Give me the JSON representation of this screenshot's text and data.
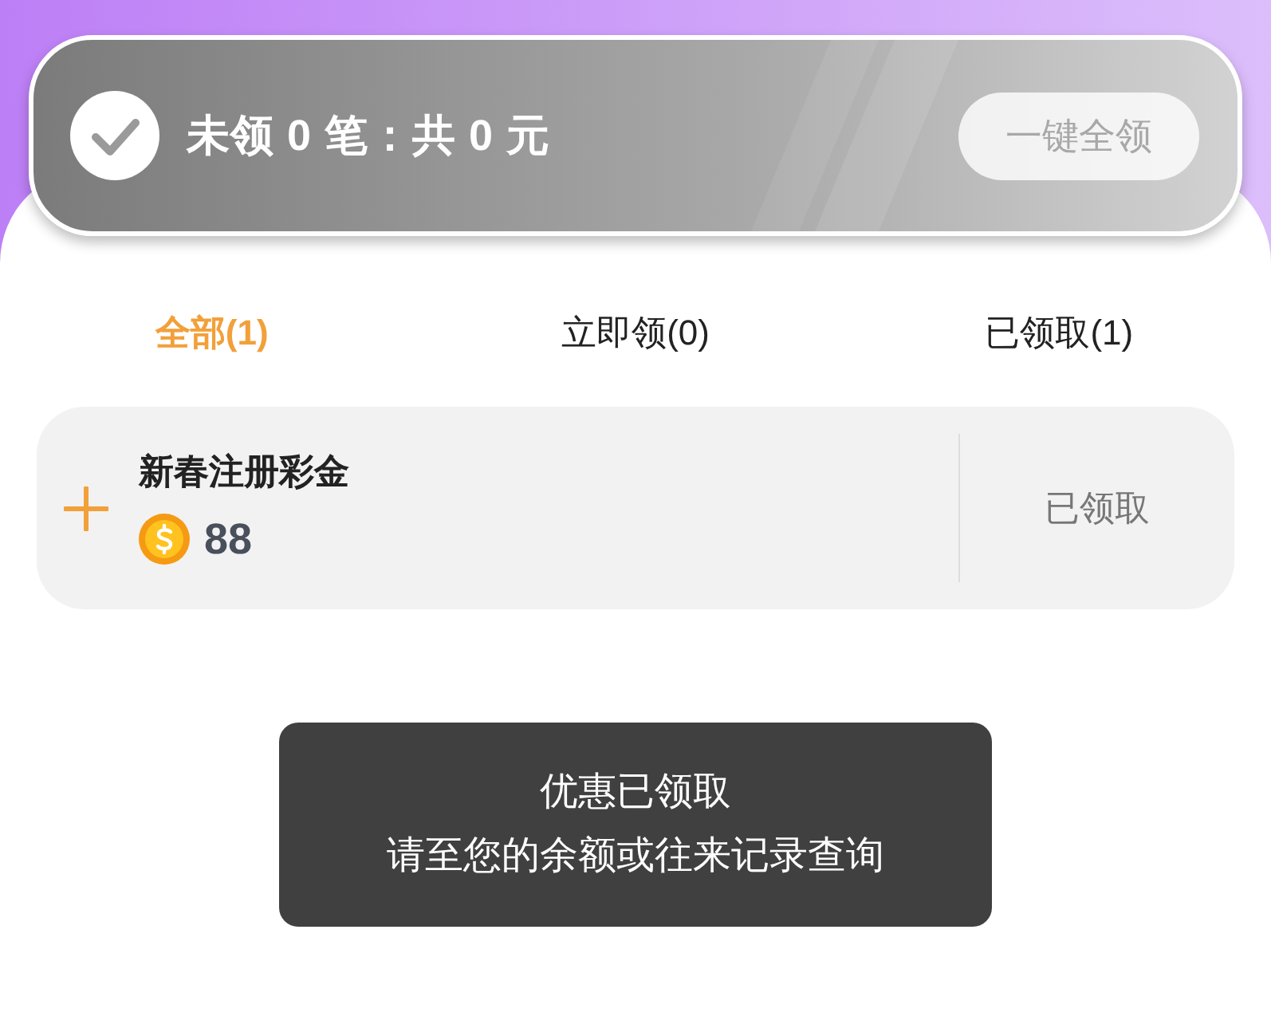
{
  "summary": {
    "text": "未领 0 笔：共 0 元",
    "button": {
      "label": "一键全领",
      "disabled": true
    }
  },
  "tabs": [
    {
      "label": "全部(1)",
      "selected": true
    },
    {
      "label": "立即领(0)",
      "selected": false
    },
    {
      "label": "已领取(1)",
      "selected": false
    }
  ],
  "items": [
    {
      "title": "新春注册彩金",
      "amount": "88",
      "status": "已领取",
      "claimed": true
    }
  ],
  "toast": {
    "title": "优惠已领取",
    "message": "请至您的余额或往来记录查询"
  }
}
